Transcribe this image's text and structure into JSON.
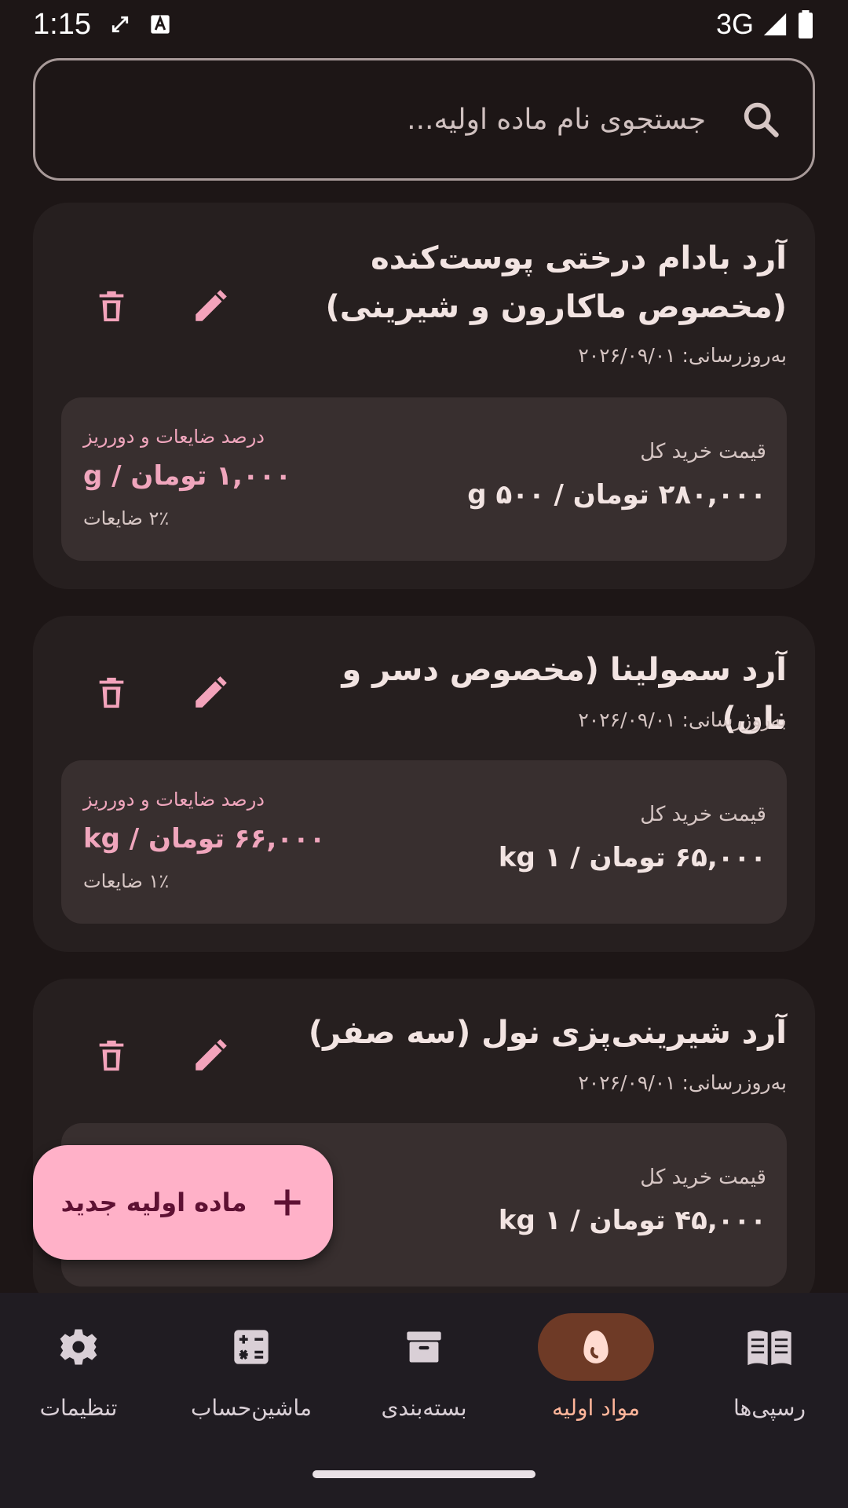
{
  "status_bar": {
    "time": "1:15",
    "network": "3G"
  },
  "search": {
    "placeholder": "جستجوی نام ماده اولیه..."
  },
  "items": [
    {
      "name": "آرد بادام درختی پوست‌کنده (مخصوص ماکارون و شیرینی)",
      "updated": "به‌روزرسانی: ۲۰۲۶/۰۹/۰۱",
      "price_label": "قیمت خرید کل",
      "price_value": "۲۸۰,۰۰۰ تومان / ۵۰۰ g",
      "waste_label": "درصد ضایعات و دورریز",
      "waste_value": "۱,۰۰۰ تومان / g",
      "waste_percent": "۲٪ ضایعات"
    },
    {
      "name": "آرد سمولینا (مخصوص دسر و نان)",
      "updated": "به‌روزرسانی: ۲۰۲۶/۰۹/۰۱",
      "price_label": "قیمت خرید کل",
      "price_value": "۶۵,۰۰۰ تومان / ۱ kg",
      "waste_label": "درصد ضایعات و دورریز",
      "waste_value": "۶۶,۰۰۰ تومان / kg",
      "waste_percent": "۱٪ ضایعات"
    },
    {
      "name": "آرد شیرینی‌پزی نول (سه صفر)",
      "updated": "به‌روزرسانی: ۲۰۲۶/۰۹/۰۱",
      "price_label": "قیمت خرید کل",
      "price_value": "۴۵,۰۰۰ تومان / ۱ kg"
    }
  ],
  "fab": {
    "label": "ماده اولیه جدید",
    "icon": "plus-icon"
  },
  "nav": [
    {
      "label": "تنظیمات",
      "icon": "gear-icon",
      "active": false
    },
    {
      "label": "ماشین‌حساب",
      "icon": "calculator-icon",
      "active": false
    },
    {
      "label": "بسته‌بندی",
      "icon": "archive-box-icon",
      "active": false
    },
    {
      "label": "مواد اولیه",
      "icon": "egg-icon",
      "active": true
    },
    {
      "label": "رسپی‌ها",
      "icon": "book-icon",
      "active": false
    }
  ],
  "colors": {
    "background": "#1d1616",
    "card": "#261f1f",
    "inner_card": "#382f2f",
    "accent_pink": "#ffb1c8",
    "icon_pink": "#f3a3bb",
    "nav_active_pill": "#6e3a26",
    "nav_active_label": "#ffb59a"
  }
}
